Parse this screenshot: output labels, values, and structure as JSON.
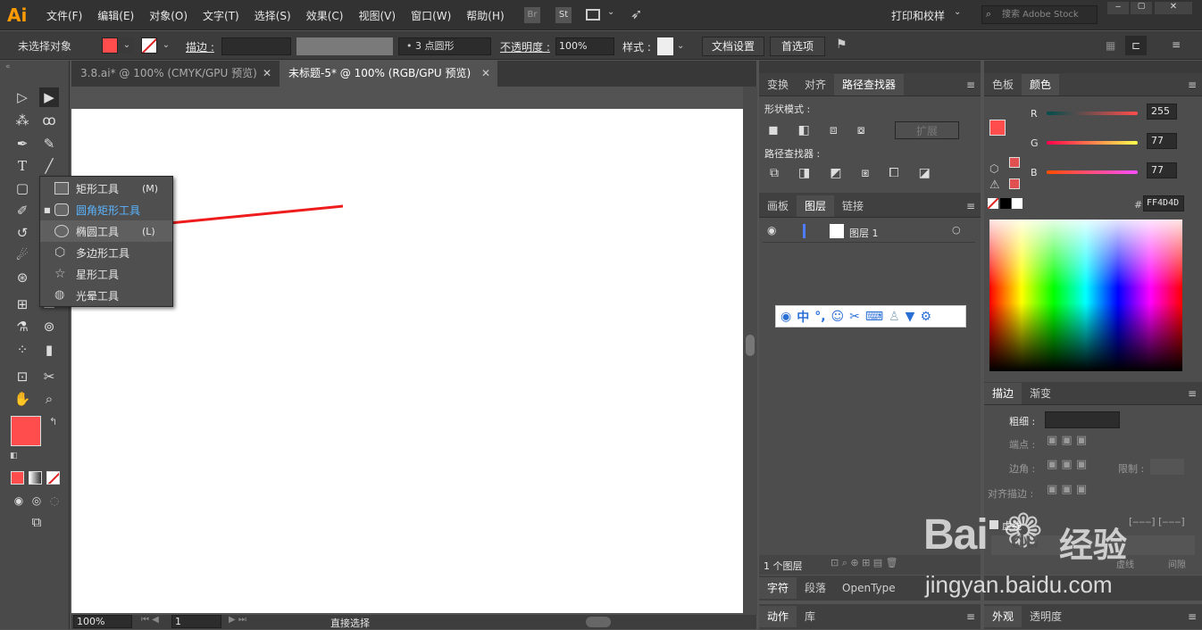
{
  "app": {
    "logo": "Ai"
  },
  "menu": [
    "文件(F)",
    "编辑(E)",
    "对象(O)",
    "文字(T)",
    "选择(S)",
    "效果(C)",
    "视图(V)",
    "窗口(W)",
    "帮助(H)"
  ],
  "menu_right": {
    "br": "Br",
    "st": "St",
    "workspace": "打印和校样",
    "search_placeholder": "搜索 Adobe Stock"
  },
  "control": {
    "selection": "未选择对象",
    "stroke_label": "描边 :",
    "brush": "3 点圆形",
    "opacity_label": "不透明度 :",
    "opacity": "100%",
    "style_label": "样式 :",
    "doc_setup": "文档设置",
    "prefs": "首选项"
  },
  "doc_tabs": [
    {
      "label": "3.8.ai* @ 100% (CMYK/GPU 预览)"
    },
    {
      "label": "未标题-5* @ 100% (RGB/GPU 预览)"
    }
  ],
  "flyout": [
    {
      "label": "矩形工具",
      "key": "(M)"
    },
    {
      "label": "圆角矩形工具",
      "key": ""
    },
    {
      "label": "椭圆工具",
      "key": "(L)"
    },
    {
      "label": "多边形工具",
      "key": ""
    },
    {
      "label": "星形工具",
      "key": ""
    },
    {
      "label": "光晕工具",
      "key": ""
    }
  ],
  "pathfinder": {
    "tabs": [
      "变换",
      "对齐",
      "路径查找器"
    ],
    "shape_modes": "形状模式 :",
    "expand": "扩展",
    "pathfinders": "路径查找器 :"
  },
  "layers": {
    "tabs": [
      "画板",
      "图层",
      "链接"
    ],
    "layer_name": "图层 1",
    "count": "1 个图层"
  },
  "ime": [
    "中",
    "°,"
  ],
  "color": {
    "tabs": [
      "色板",
      "颜色"
    ],
    "r_label": "R",
    "g_label": "G",
    "b_label": "B",
    "r": "255",
    "g": "77",
    "b": "77",
    "hex_label": "#",
    "hex": "FF4D4D",
    "fill": "#ff4d4d"
  },
  "stroke_panel": {
    "tabs": [
      "描边",
      "渐变"
    ],
    "weight": "粗细 :",
    "cap": "端点 :",
    "corner": "边角 :",
    "limit": "限制 :",
    "align": "对齐描边 :",
    "dashed": "虚线",
    "dash": "虚线",
    "gap": "间隙"
  },
  "bottom_panels": {
    "char": "字符",
    "para": "段落",
    "opentype": "OpenType",
    "actions": "动作",
    "library": "库",
    "appearance": "外观",
    "transparency": "透明度"
  },
  "status": {
    "zoom": "100%",
    "page": "1",
    "tool": "直接选择"
  },
  "watermark": {
    "brand": "Bai",
    "brand2": "du",
    "cn": "经验",
    "url": "jingyan.baidu.com"
  }
}
